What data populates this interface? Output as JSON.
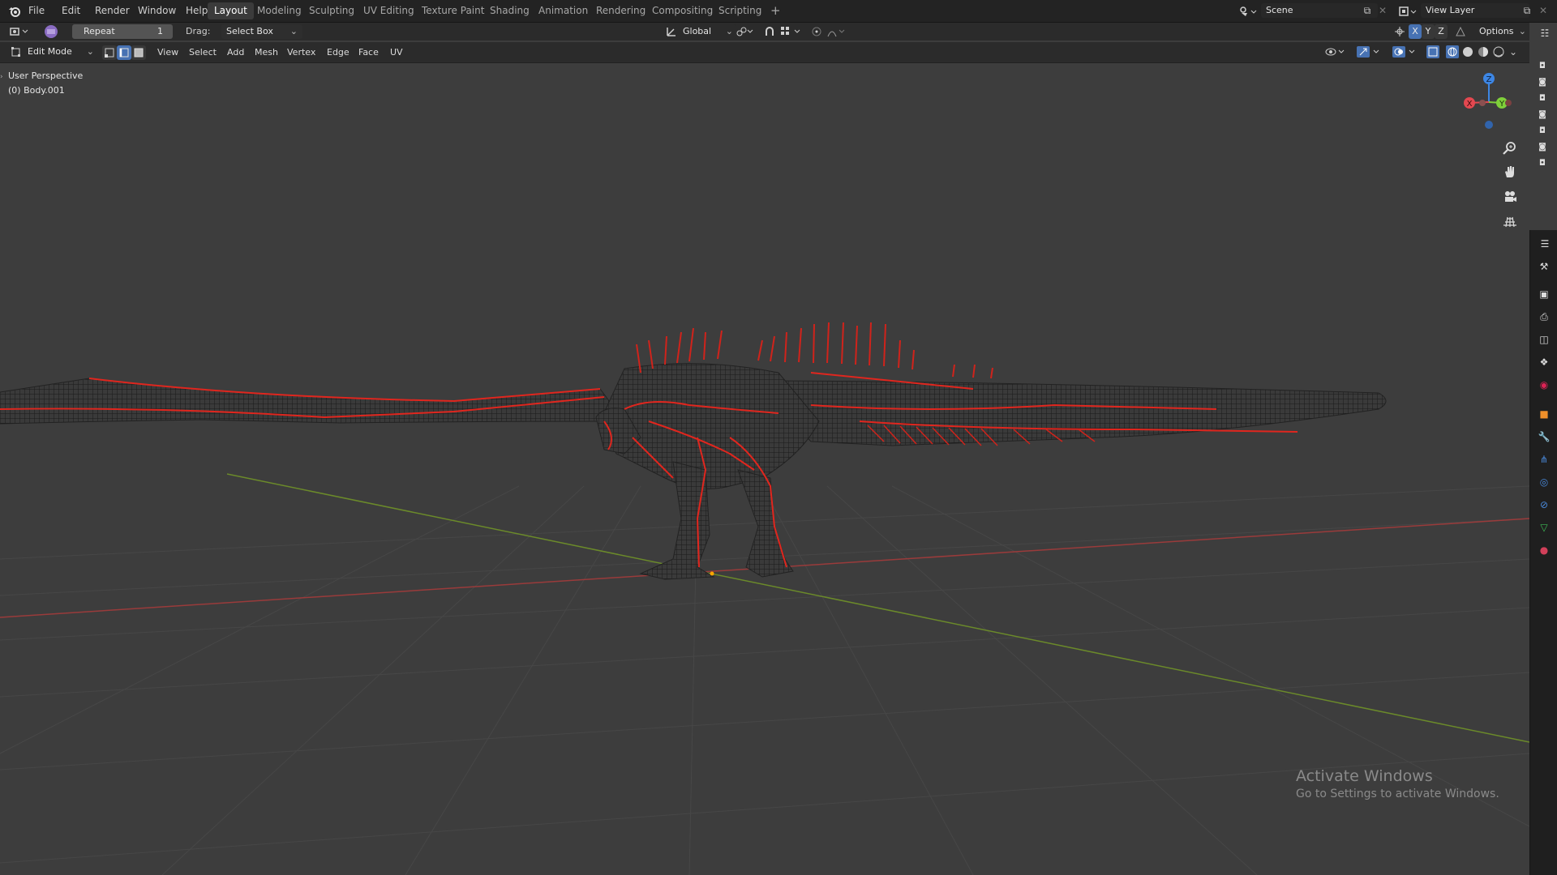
{
  "topbar": {
    "menu": [
      "File",
      "Edit",
      "Render",
      "Window",
      "Help"
    ],
    "workspaces": [
      "Layout",
      "Modeling",
      "Sculpting",
      "UV Editing",
      "Texture Paint",
      "Shading",
      "Animation",
      "Rendering",
      "Compositing",
      "Scripting"
    ],
    "active_workspace": "Layout",
    "add_tab": "+",
    "scene_label": "Scene",
    "view_layer_label": "View Layer"
  },
  "toolheader": {
    "repeat_label": "Repeat",
    "repeat_value": "1",
    "drag_label": "Drag:",
    "drag_value": "Select Box",
    "orientation": "Global",
    "axis_x": "X",
    "axis_y": "Y",
    "axis_z": "Z",
    "options_label": "Options"
  },
  "viewheader": {
    "mode": "Edit Mode",
    "menus": [
      "View",
      "Select",
      "Add",
      "Mesh",
      "Vertex",
      "Edge",
      "Face",
      "UV"
    ]
  },
  "viewport": {
    "perspective_label": "User Perspective",
    "object_label": "(0) Body.001",
    "gizmo_x": "X",
    "gizmo_y": "Y",
    "gizmo_z": "Z"
  },
  "watermark": {
    "title": "Activate Windows",
    "subtitle": "Go to Settings to activate Windows."
  },
  "colors": {
    "background": "#3d3d3d",
    "wire": "#1e1e1e",
    "seam": "#e0261e",
    "x_axis": "#9a3b3b",
    "y_axis": "#6b8a2a",
    "gizmo_x": "#e34850",
    "gizmo_y": "#7fcf3a",
    "gizmo_z": "#3d86e4"
  }
}
